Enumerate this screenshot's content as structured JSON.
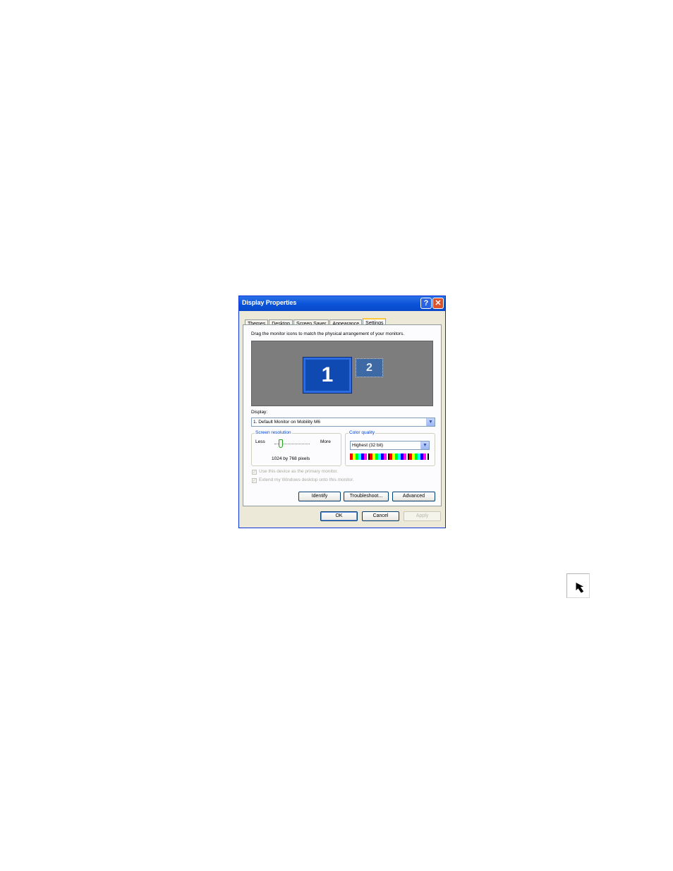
{
  "window": {
    "title": "Display Properties",
    "help_glyph": "?",
    "close_glyph": "✕"
  },
  "tabs": [
    {
      "label": "Themes"
    },
    {
      "label": "Desktop"
    },
    {
      "label": "Screen Saver"
    },
    {
      "label": "Appearance"
    },
    {
      "label": "Settings",
      "active": true
    }
  ],
  "settings": {
    "instruction": "Drag the monitor icons to match the physical arrangement of your monitors.",
    "monitors": [
      {
        "label": "1",
        "selected": true
      },
      {
        "label": "2",
        "selected": false
      }
    ],
    "display_label": "Display:",
    "display_value": "1. Default Monitor on Mobility M6",
    "resolution": {
      "group_title": "Screen resolution",
      "less_label": "Less",
      "more_label": "More",
      "value_text": "1024 by 768 pixels"
    },
    "color_quality": {
      "group_title": "Color quality",
      "value": "Highest (32 bit)"
    },
    "checkboxes": [
      {
        "label": "Use this device as the primary monitor.",
        "checked": true,
        "enabled": false
      },
      {
        "label": "Extend my Windows desktop onto this monitor.",
        "checked": true,
        "enabled": false
      }
    ],
    "buttons": {
      "identify": "Identify",
      "troubleshoot": "Troubleshoot...",
      "advanced": "Advanced"
    }
  },
  "footer_buttons": {
    "ok": "OK",
    "cancel": "Cancel",
    "apply": "Apply"
  },
  "colors": {
    "title_bar": "#0a53d8",
    "dialog_bg": "#ece9d8",
    "monitor_bg": "#7d7d7d",
    "monitor_selected": "#0f4ab3"
  },
  "icons": {
    "dropdown_arrow": "chevron-down-icon",
    "cursor": "arrow-cursor-icon"
  }
}
